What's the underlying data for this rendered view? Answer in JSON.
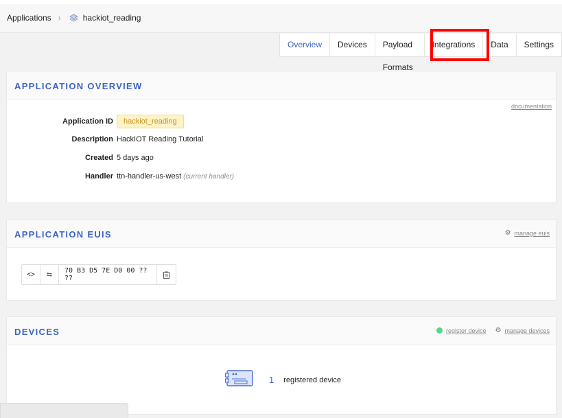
{
  "breadcrumb": {
    "root": "Applications",
    "current": "hackiot_reading"
  },
  "tabs": [
    "Overview",
    "Devices",
    "Payload Formats",
    "Integrations",
    "Data",
    "Settings"
  ],
  "overview": {
    "title": "APPLICATION OVERVIEW",
    "documentation_link": "documentation",
    "fields": {
      "app_id_label": "Application ID",
      "app_id_value": "hackiot_reading",
      "description_label": "Description",
      "description_value": "HackIOT Reading Tutorial",
      "created_label": "Created",
      "created_value": "5 days ago",
      "handler_label": "Handler",
      "handler_value": "ttn-handler-us-west",
      "handler_note": "(current handler)"
    }
  },
  "euis": {
    "title": "APPLICATION EUIS",
    "manage_link": "manage euis",
    "eui_value": "70 B3 D5 7E D0 00 ?? ??"
  },
  "devices": {
    "title": "DEVICES",
    "register_link": "register device",
    "manage_link": "manage devices",
    "count": "1",
    "count_label": "registered device"
  },
  "colors": {
    "accent": "#3c63c4",
    "highlight": "#ff0000",
    "badge_bg": "#fdf3c6",
    "status_green": "#52d98a"
  },
  "icons": {
    "breadcrumb_separator": "chevron-right-icon",
    "application": "stack-icon",
    "code_toggle": "code-icon",
    "byte_order": "swap-icon",
    "copy": "clipboard-icon",
    "settings": "gear-icon",
    "device": "device-board-icon"
  }
}
